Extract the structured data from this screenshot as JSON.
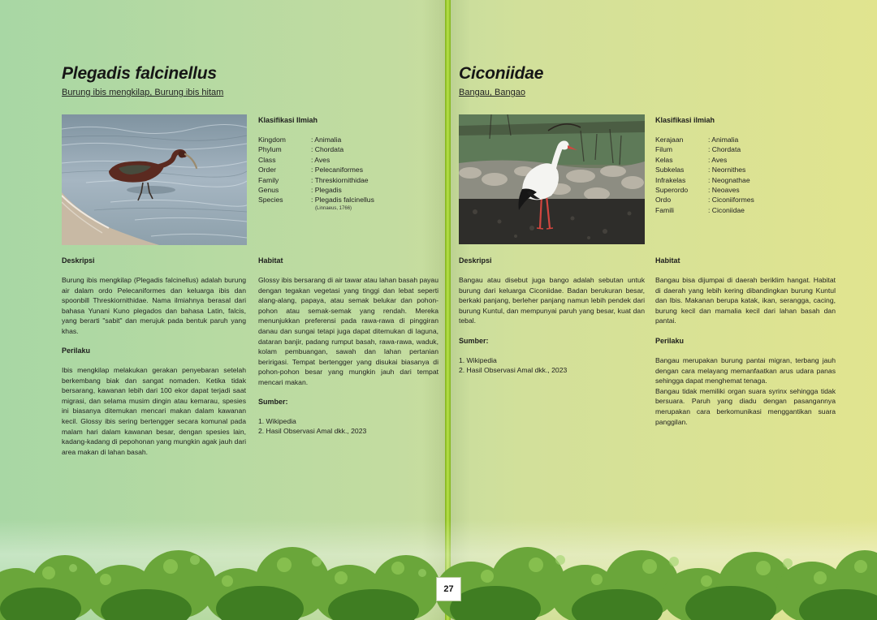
{
  "page_number": "27",
  "colors": {
    "background_left": "#a8d7a4",
    "background_right": "#e1e48f",
    "spine": "#9ccc2e",
    "foliage": "#4f8f2a"
  },
  "left": {
    "title": "Plegadis falcinellus",
    "subtitle": "Burung ibis mengkilap, Burung ibis hitam",
    "photo_icon": "glossy-ibis-photo",
    "classification_heading": "Klasifikasi Ilmiah",
    "classification": [
      {
        "key": "Kingdom",
        "value": ": Animalia"
      },
      {
        "key": "Phylum",
        "value": ": Chordata"
      },
      {
        "key": "Class",
        "value": ": Aves"
      },
      {
        "key": "Order",
        "value": ": Pelecaniformes"
      },
      {
        "key": "Family",
        "value": ": Threskiornithidae"
      },
      {
        "key": "Genus",
        "value": ": Plegadis"
      },
      {
        "key": "Species",
        "value": ": Plegadis falcinellus"
      }
    ],
    "authority": "(Linnaeus, 1766)",
    "description_heading": "Deskripsi",
    "description": "Burung ibis mengkilap (Plegadis falcinellus) adalah burung air dalam ordo Pelecaniformes dan keluarga ibis dan spoonbill Threskiornithidae. Nama ilmiahnya berasal dari bahasa Yunani Kuno plegados dan bahasa Latin, falcis, yang berarti \"sabit\" dan merujuk pada bentuk paruh yang khas.",
    "behavior_heading": "Perilaku",
    "behavior": "Ibis mengkilap melakukan gerakan penyebaran setelah berkembang biak dan sangat nomaden. Ketika tidak bersarang, kawanan lebih dari 100 ekor dapat terjadi saat migrasi, dan selama musim dingin atau kemarau, spesies ini biasanya ditemukan mencari makan dalam kawanan kecil. Glossy ibis sering bertengger secara komunal pada malam hari dalam kawanan besar, dengan spesies lain, kadang-kadang di pepohonan yang mungkin agak jauh dari area makan di lahan basah.",
    "habitat_heading": "Habitat",
    "habitat": "Glossy ibis bersarang di air tawar atau lahan basah payau dengan tegakan vegetasi yang tinggi dan lebat seperti alang-alang, papaya, atau semak belukar dan pohon-pohon atau semak-semak yang rendah. Mereka menunjukkan preferensi pada rawa-rawa di pinggiran danau dan sungai tetapi juga dapat ditemukan di laguna, dataran banjir, padang rumput basah, rawa-rawa, waduk, kolam pembuangan, sawah dan lahan pertanian beririgasi. Tempat bertengger yang disukai biasanya di pohon-pohon besar yang mungkin jauh dari tempat mencari makan.",
    "sources_heading": "Sumber:",
    "sources": [
      "1. Wikipedia",
      "2. Hasil Observasi Amal dkk., 2023"
    ]
  },
  "right": {
    "title": "Ciconiidae",
    "subtitle": "Bangau, Bangao",
    "photo_icon": "white-stork-photo",
    "classification_heading": "Klasifikasi ilmiah",
    "classification": [
      {
        "key": "Kerajaan",
        "value": ": Animalia"
      },
      {
        "key": "Filum",
        "value": ": Chordata"
      },
      {
        "key": "Kelas",
        "value": ": Aves"
      },
      {
        "key": "Subkelas",
        "value": ": Neornithes"
      },
      {
        "key": "Infrakelas",
        "value": ": Neognathae"
      },
      {
        "key": "Superordo",
        "value": ": Neoaves"
      },
      {
        "key": "Ordo",
        "value": ": Ciconiiformes"
      },
      {
        "key": "Famili",
        "value": ": Ciconiidae"
      }
    ],
    "description_heading": "Deskripsi",
    "description": "Bangau atau disebut juga bango adalah sebutan untuk burung dari keluarga Ciconiidae. Badan berukuran besar, berkaki panjang, berleher panjang namun lebih pendek dari burung Kuntul, dan mempunyai paruh yang besar, kuat dan tebal.",
    "sources_heading": "Sumber:",
    "sources": [
      "1. Wikipedia",
      "2. Hasil Observasi Amal dkk., 2023"
    ],
    "habitat_heading": "Habitat",
    "habitat": "Bangau bisa dijumpai di daerah beriklim hangat. Habitat di daerah yang lebih kering dibandingkan burung Kuntul dan Ibis. Makanan berupa katak, ikan, serangga, cacing, burung kecil dan mamalia kecil dari lahan basah dan pantai.",
    "behavior_heading": "Perilaku",
    "behavior": "Bangau merupakan burung pantai migran, terbang jauh dengan cara melayang memanfaatkan arus udara panas sehingga dapat menghemat tenaga.\nBangau tidak memiliki organ suara syrinx sehingga tidak bersuara. Paruh yang diadu dengan pasangannya merupakan cara berkomunikasi menggantikan suara panggilan."
  }
}
